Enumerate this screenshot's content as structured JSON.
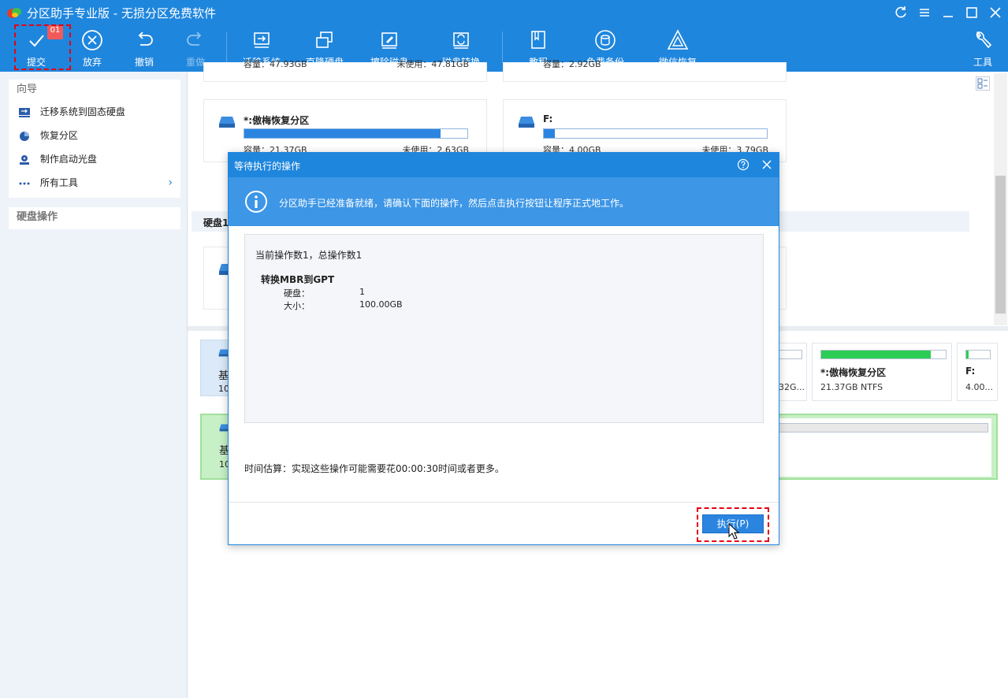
{
  "window": {
    "title": "分区助手专业版 - 无损分区免费软件"
  },
  "toolbar": {
    "submit": {
      "label": "提交",
      "badge": "01"
    },
    "discard": "放弃",
    "undo": "撤销",
    "redo": "重做",
    "migrate": "迁移系统",
    "clone": "克隆硬盘",
    "wipe": "擦除磁盘",
    "convert": "磁盘转换",
    "tutorial": "教程",
    "backup": "免费备份",
    "wechat": "微信恢复",
    "tools": "工具"
  },
  "sidebar": {
    "wizard_title": "向导",
    "items": [
      "迁移系统到固态硬盘",
      "恢复分区",
      "制作启动光盘",
      "所有工具"
    ],
    "disk_ops_title": "硬盘操作"
  },
  "main": {
    "top_row": {
      "left_cap": "容量：47.93GB",
      "left_free": "未使用：47.81GB",
      "right_cap": "容量：2.92GB"
    },
    "cards": [
      {
        "name": "*:傲梅恢复分区",
        "capacity": "容量：21.37GB",
        "free": "未使用：2.63GB",
        "fill": 0.88
      },
      {
        "name": "F:",
        "capacity": "容量：4.00GB",
        "free": "未使用：3.79GB",
        "fill": 0.05
      }
    ],
    "disk_label": "硬盘1",
    "map_row1": {
      "left_name": "基",
      "left_info": "10",
      "mid_info": "32G...",
      "p2_name": "*:傲梅恢复分区",
      "p2_info": "21.37GB NTFS",
      "p2_fill": 0.88,
      "p3_name": "F:",
      "p3_info": "4.00...",
      "p3_fill": 0.1
    },
    "map_row2": {
      "left_name": "基",
      "left_info": "10"
    }
  },
  "dialog": {
    "title": "等待执行的操作",
    "banner": "分区助手已经准备就绪，请确认下面的操作，然后点击执行按钮让程序正式地工作。",
    "ops_count": "当前操作数1，总操作数1",
    "op_title": "转换MBR到GPT",
    "op_details": [
      {
        "key": "硬盘：",
        "value": "1"
      },
      {
        "key": "大小：",
        "value": "100.00GB"
      }
    ],
    "time_estimate": "时间估算：实现这些操作可能需要花00:00:30时间或者更多。",
    "execute_label": "执行(P)"
  },
  "colors": {
    "brand_blue": "#1f86dd",
    "highlight_red": "#e60012",
    "bar_green": "#2ccd55"
  }
}
